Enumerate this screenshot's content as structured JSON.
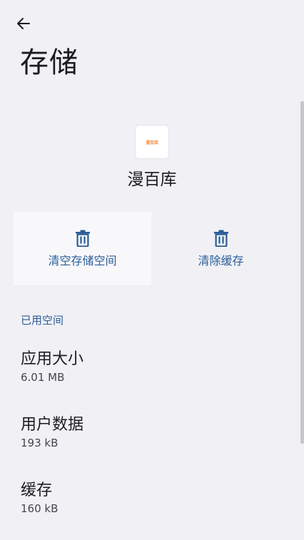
{
  "header": {
    "title": "存储"
  },
  "app": {
    "name": "漫百库",
    "icon_text": "漫百库"
  },
  "actions": {
    "clear_storage_label": "清空存储空间",
    "clear_cache_label": "清除缓存"
  },
  "usage": {
    "section_title": "已用空间",
    "items": [
      {
        "label": "应用大小",
        "value": "6.01 MB"
      },
      {
        "label": "用户数据",
        "value": "193 kB"
      },
      {
        "label": "缓存",
        "value": "160 kB"
      }
    ]
  },
  "colors": {
    "accent": "#2a5d96",
    "background": "#f1f0f5",
    "icon_text": "#f08a3a"
  }
}
